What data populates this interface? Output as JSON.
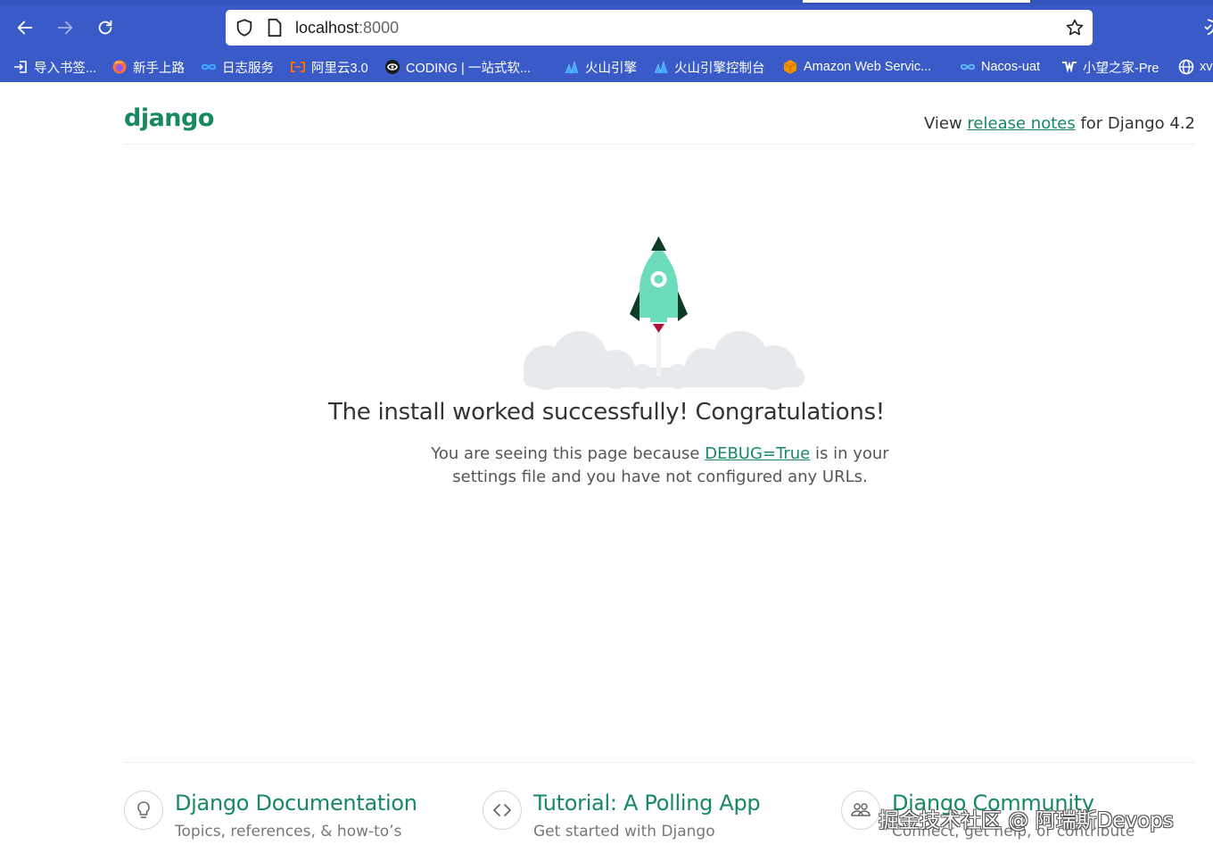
{
  "browser": {
    "url_host": "localhost",
    "url_port": ":8000",
    "bookmarks": [
      {
        "label": "导入书签...",
        "icon": "import-icon",
        "color": "#ffffff"
      },
      {
        "label": "新手上路",
        "icon": "firefox-icon",
        "color": "#ff7139"
      },
      {
        "label": "日志服务",
        "icon": "infinity-icon",
        "color": "#3fa9ff"
      },
      {
        "label": "阿里云3.0",
        "icon": "aliyun-icon",
        "color": "#ff6a00"
      },
      {
        "label": "CODING | 一站式软...",
        "icon": "coding-icon",
        "color": "#1a1a1a"
      },
      {
        "label": "火山引擎",
        "icon": "volcano-icon",
        "color": "#3fa9ff"
      },
      {
        "label": "火山引擎控制台",
        "icon": "volcano-icon",
        "color": "#3fa9ff"
      },
      {
        "label": "Amazon Web Servic...",
        "icon": "aws-cube-icon",
        "color": "#f29100"
      },
      {
        "label": "Nacos-uat",
        "icon": "infinity-icon",
        "color": "#5fb6ff"
      },
      {
        "label": "小望之家-Pre",
        "icon": "w-logo-icon",
        "color": "#ffffff"
      },
      {
        "label": "xv",
        "icon": "globe-icon",
        "color": "#ffffff"
      }
    ]
  },
  "page": {
    "logo": "django",
    "release_prefix": "View ",
    "release_link": "release notes",
    "release_suffix": " for Django 4.2",
    "headline": "The install worked successfully! Congratulations!",
    "sub_prefix": "You are seeing this page because ",
    "sub_link": "DEBUG=True",
    "sub_suffix": " is in your settings file and you have not configured any URLs.",
    "cards": [
      {
        "title": "Django Documentation",
        "desc": "Topics, references, & how-to’s",
        "icon": "lightbulb-icon"
      },
      {
        "title": "Tutorial: A Polling App",
        "desc": "Get started with Django",
        "icon": "code-icon"
      },
      {
        "title": "Django Community",
        "desc": "Connect, get help, or contribute",
        "icon": "people-icon"
      }
    ],
    "watermark": "掘金技术社区 @ 阿瑞斯Devops"
  },
  "colors": {
    "chrome": "#3a5bc7",
    "django_green": "#168a5e",
    "rocket_body": "#6ddcbd",
    "cloud": "#e7eaec"
  }
}
